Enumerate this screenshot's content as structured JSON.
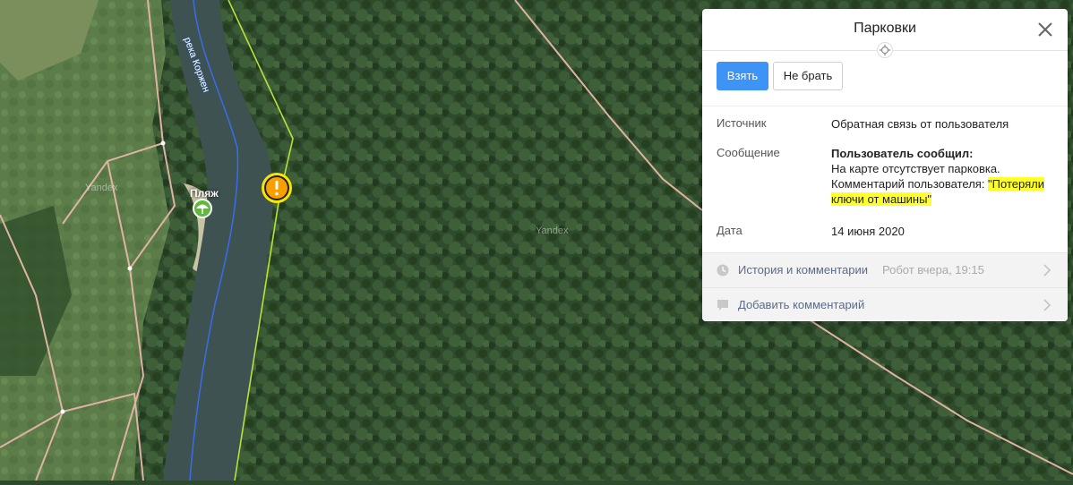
{
  "map": {
    "river_label": "река Коржен",
    "beach_label": "Пляж",
    "watermark": "Yandex",
    "colors": {
      "forest": "#2e4a2c",
      "river": "#3d5251",
      "meadow": "#5d7f4a",
      "road": "#e0b2a4",
      "boundary": "#b8e23a",
      "river_line": "#3a6be0",
      "marker": "#f7a000"
    },
    "icons": {
      "beach": "beach-umbrella-icon",
      "alert": "exclamation-icon"
    }
  },
  "panel": {
    "title": "Парковки",
    "take_label": "Взять",
    "decline_label": "Не брать",
    "source_label": "Источник",
    "source_value": "Обратная связь от пользователя",
    "message_label": "Сообщение",
    "message_heading": "Пользователь сообщил:",
    "message_line1": "На карте отсутствует парковка.",
    "message_comment_prefix": "Комментарий пользователя: ",
    "message_comment_text": "\"Потеряли ключи от машины\"",
    "date_label": "Дата",
    "date_value": "14 июня 2020",
    "history_label": "История и комментарии",
    "history_meta": "Робот вчера, 19:15",
    "add_comment_label": "Добавить комментарий",
    "colors": {
      "primary": "#3d93f6",
      "highlight": "#ffff2b",
      "link": "#5b6b88"
    }
  }
}
